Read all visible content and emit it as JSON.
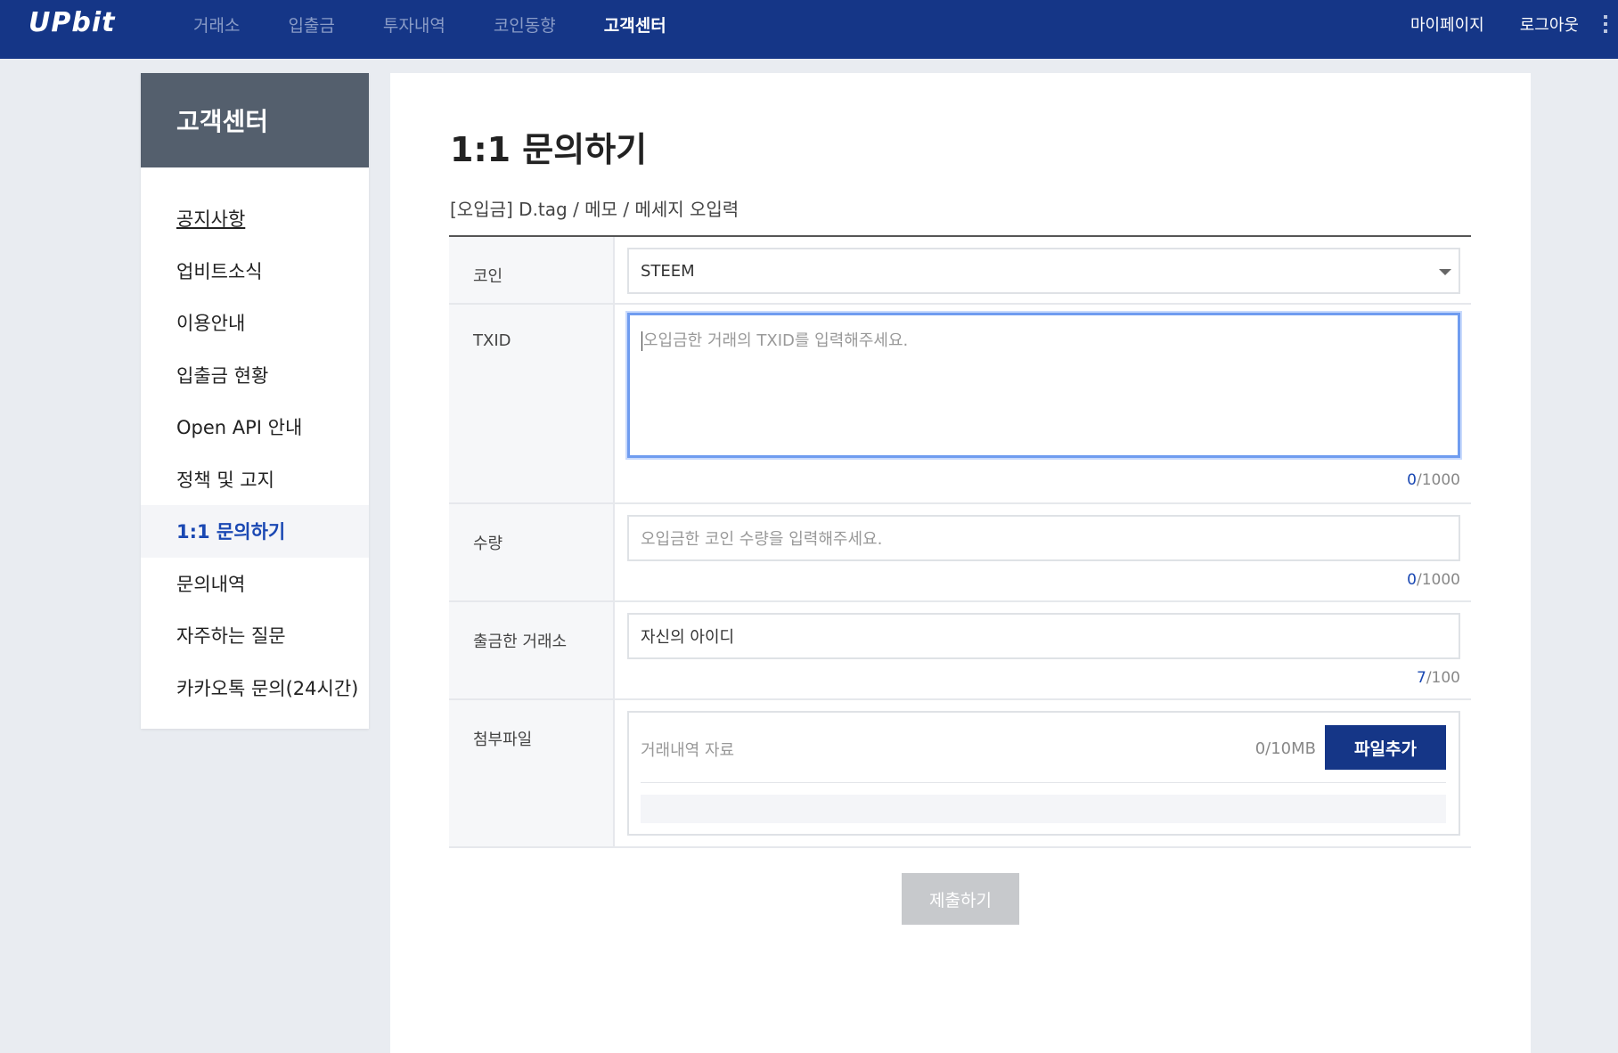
{
  "header": {
    "logo": "UPbit",
    "nav": [
      "거래소",
      "입출금",
      "투자내역",
      "코인동향",
      "고객센터"
    ],
    "active_nav": "고객센터",
    "mypage": "마이페이지",
    "logout": "로그아웃"
  },
  "sidebar": {
    "title": "고객센터",
    "items": [
      {
        "label": "공지사항"
      },
      {
        "label": "업비트소식"
      },
      {
        "label": "이용안내"
      },
      {
        "label": "입출금 현황"
      },
      {
        "label": "Open API 안내"
      },
      {
        "label": "정책 및 고지"
      },
      {
        "label": "1:1 문의하기"
      },
      {
        "label": "문의내역"
      },
      {
        "label": "자주하는 질문"
      },
      {
        "label": "카카오톡 문의(24시간)"
      }
    ]
  },
  "main": {
    "title": "1:1 문의하기",
    "subtitle": "[오입금] D.tag / 메모 / 메세지 오입력",
    "coin": {
      "label": "코인",
      "value": "STEEM"
    },
    "txid": {
      "label": "TXID",
      "placeholder": "오입금한 거래의 TXID를 입력해주세요.",
      "count": "0",
      "max": "/1000"
    },
    "amount": {
      "label": "수량",
      "placeholder": "오입금한 코인 수량을 입력해주세요.",
      "count": "0",
      "max": "/1000"
    },
    "exchange": {
      "label": "출금한 거래소",
      "value": "자신의 아이디",
      "count": "7",
      "max": "/100"
    },
    "attachment": {
      "label": "첨부파일",
      "placeholder": "거래내역 자료",
      "size": "0/10MB",
      "button": "파일추가"
    },
    "submit": "제출하기"
  },
  "colors": {
    "brand": "#153687",
    "active_link": "#1a48b3",
    "focus_border": "#6f9cf0",
    "submit_disabled": "#c7c9cc"
  }
}
